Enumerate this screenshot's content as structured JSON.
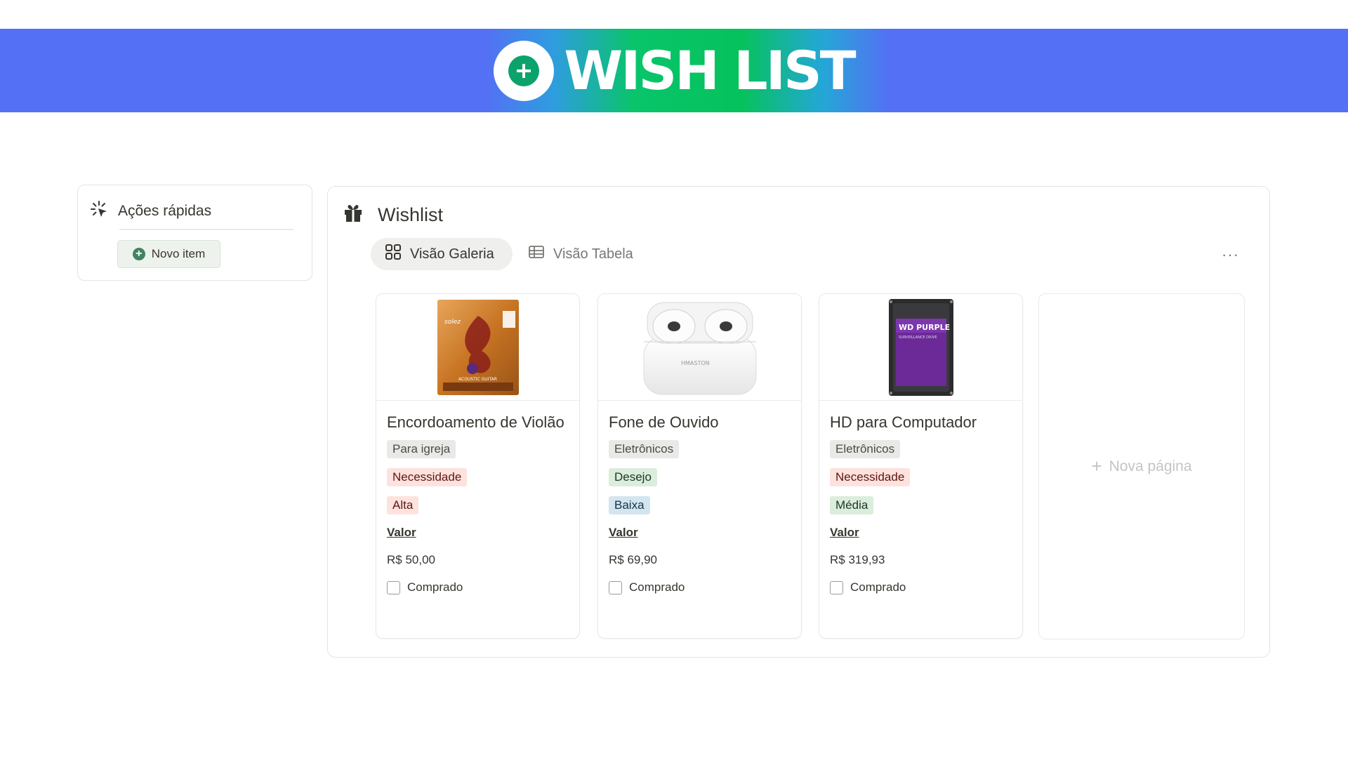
{
  "banner": {
    "title": "WISH LIST",
    "icon": "plus-circle-icon"
  },
  "quick_actions": {
    "title": "Ações rápidas",
    "icon": "sparkle-cursor-icon",
    "button_label": "Novo item",
    "button_icon": "plus-circle-icon"
  },
  "wishlist": {
    "title": "Wishlist",
    "icon": "gift-icon",
    "tabs": [
      {
        "label": "Visão Galeria",
        "icon": "gallery-grid-icon",
        "active": true
      },
      {
        "label": "Visão Tabela",
        "icon": "table-icon",
        "active": false
      }
    ],
    "more": "···",
    "property_label": "Valor",
    "checkbox_label": "Comprado",
    "new_page_label": "Nova página",
    "cards": [
      {
        "title": "Encordoamento de Violão",
        "image": "guitar-strings-package",
        "tags": [
          {
            "text": "Para igreja",
            "color": "gray"
          },
          {
            "text": "Necessidade",
            "color": "red"
          },
          {
            "text": "Alta",
            "color": "red"
          }
        ],
        "valor": "R$ 50,00",
        "comprado": false
      },
      {
        "title": "Fone de Ouvido",
        "image": "wireless-earbuds-case",
        "tags": [
          {
            "text": "Eletrônicos",
            "color": "gray"
          },
          {
            "text": "Desejo",
            "color": "green"
          },
          {
            "text": "Baixa",
            "color": "blue"
          }
        ],
        "valor": "R$ 69,90",
        "comprado": false
      },
      {
        "title": "HD para Computador",
        "image": "wd-purple-hard-drive",
        "tags": [
          {
            "text": "Eletrônicos",
            "color": "gray"
          },
          {
            "text": "Necessidade",
            "color": "red"
          },
          {
            "text": "Média",
            "color": "green"
          }
        ],
        "valor": "R$ 319,93",
        "comprado": false
      }
    ]
  },
  "images_text": {
    "strings_brand": "solez",
    "strings_sub": "ACOUSTIC GUITAR",
    "earbuds_brand": "HMASTON",
    "hd_brand": "WD PURPLE",
    "hd_sub": "SURVEILLANCE DRIVE"
  }
}
